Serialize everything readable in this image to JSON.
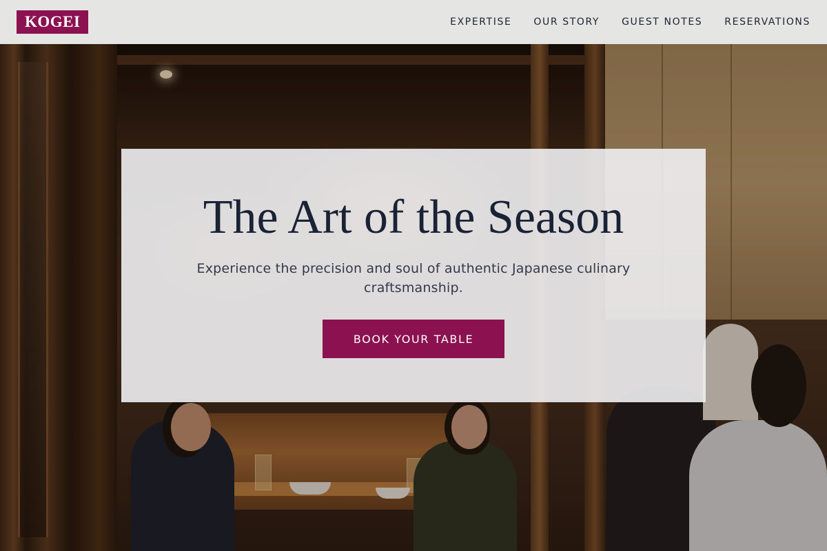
{
  "nav": {
    "logo": "KOGEI",
    "links": [
      "EXPERTISE",
      "OUR STORY",
      "GUEST NOTES",
      "RESERVATIONS"
    ]
  },
  "hero": {
    "title": "The Art of the Season",
    "subtitle": "Experience the precision and soul of authentic Japanese culinary craftsmanship.",
    "cta_label": "BOOK YOUR TABLE",
    "background": "restaurant-interior-photo"
  },
  "colors": {
    "accent": "#8b1150",
    "heading": "#1a2236",
    "nav_background": "#f0f0f0"
  }
}
